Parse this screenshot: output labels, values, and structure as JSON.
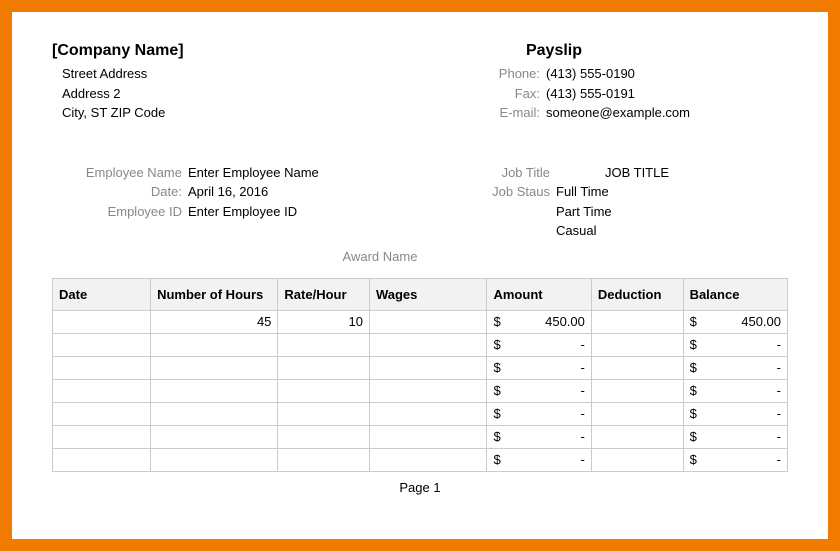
{
  "header": {
    "company_name": "[Company Name]",
    "address_line1": "Street Address",
    "address_line2": "Address 2",
    "address_line3": "City, ST  ZIP Code",
    "payslip_title": "Payslip",
    "phone_label": "Phone:",
    "phone_value": "(413) 555-0190",
    "fax_label": "Fax:",
    "fax_value": "(413) 555-0191",
    "email_label": "E-mail:",
    "email_value": "someone@example.com"
  },
  "employee": {
    "name_label": "Employee Name",
    "name_value": "Enter Employee Name",
    "date_label": "Date:",
    "date_value": "April 16, 2016",
    "id_label": "Employee ID",
    "id_value": "Enter Employee ID",
    "jobtitle_label": "Job Title",
    "jobtitle_value": "JOB TITLE",
    "jobstatus_label": "Job Staus",
    "jobstatus_values": [
      "Full Time",
      "Part Time",
      "Casual"
    ],
    "award_label": "Award Name"
  },
  "table": {
    "headers": {
      "date": "Date",
      "hours": "Number of Hours",
      "rate": "Rate/Hour",
      "wages": "Wages",
      "amount": "Amount",
      "deduction": "Deduction",
      "balance": "Balance"
    },
    "currency_symbol": "$",
    "rows": [
      {
        "date": "",
        "hours": "45",
        "rate": "10",
        "wages": "",
        "amount": "450.00",
        "deduction": "",
        "balance": "450.00"
      },
      {
        "date": "",
        "hours": "",
        "rate": "",
        "wages": "",
        "amount": "-",
        "deduction": "",
        "balance": "-"
      },
      {
        "date": "",
        "hours": "",
        "rate": "",
        "wages": "",
        "amount": "-",
        "deduction": "",
        "balance": "-"
      },
      {
        "date": "",
        "hours": "",
        "rate": "",
        "wages": "",
        "amount": "-",
        "deduction": "",
        "balance": "-"
      },
      {
        "date": "",
        "hours": "",
        "rate": "",
        "wages": "",
        "amount": "-",
        "deduction": "",
        "balance": "-"
      },
      {
        "date": "",
        "hours": "",
        "rate": "",
        "wages": "",
        "amount": "-",
        "deduction": "",
        "balance": "-"
      },
      {
        "date": "",
        "hours": "",
        "rate": "",
        "wages": "",
        "amount": "-",
        "deduction": "",
        "balance": "-"
      }
    ]
  },
  "footer": {
    "page": "Page 1"
  }
}
